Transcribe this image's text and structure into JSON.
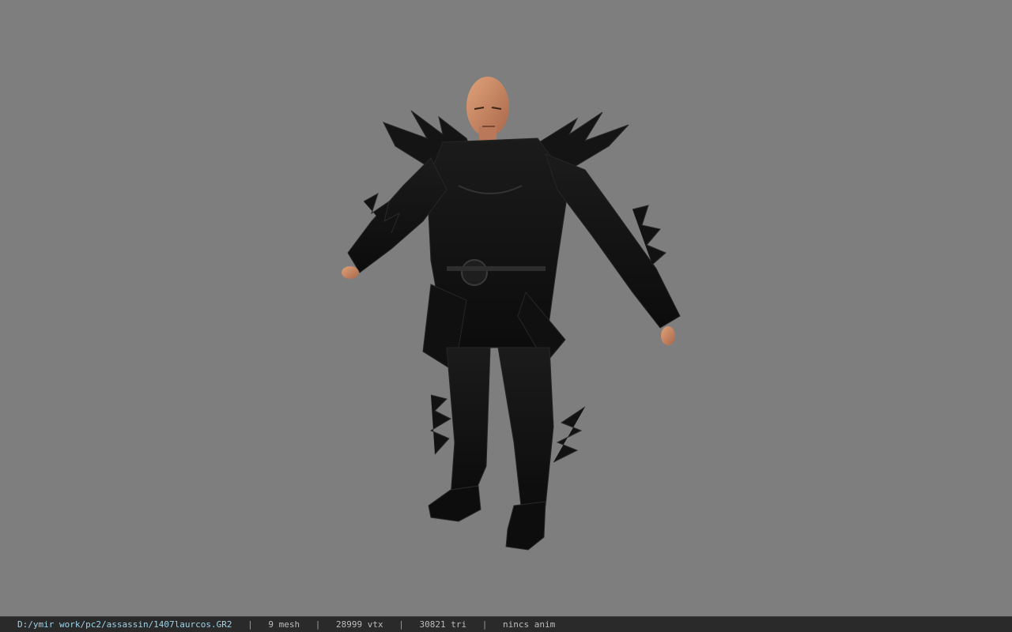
{
  "viewport": {
    "background": "#7e7e7e",
    "model_icon": "character-model"
  },
  "status": {
    "path": "D:/ymir work/pc2/assassin/1407laurcos.GR2",
    "separator": "|",
    "mesh": "9 mesh",
    "vtx": "28999 vtx",
    "tri": "30821 tri",
    "anim": "nincs anim"
  }
}
